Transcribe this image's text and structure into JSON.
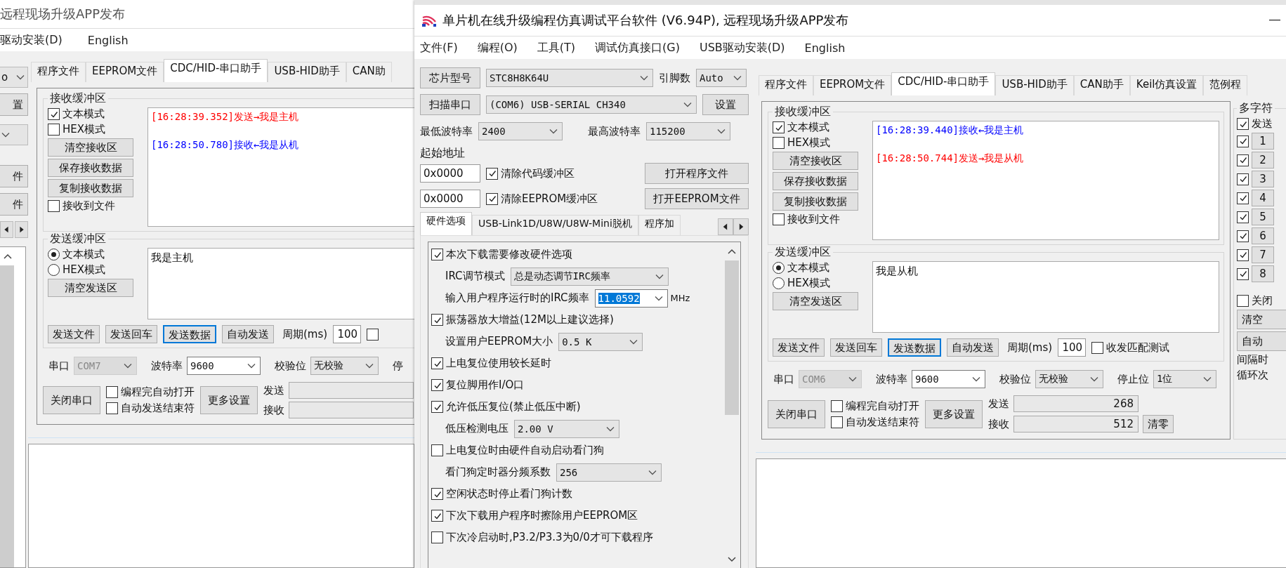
{
  "back_window": {
    "title": "远程现场升级APP发布",
    "menu": [
      "驱动安装(D)",
      "English"
    ],
    "edge_items": [
      {
        "kind": "combo",
        "value": "o"
      },
      {
        "kind": "button",
        "label": "置"
      },
      {
        "kind": "combo"
      },
      {
        "kind": "button",
        "label": "件"
      },
      {
        "kind": "button",
        "label": "件"
      },
      {
        "kind": "arrows"
      },
      {
        "kind": "list"
      }
    ],
    "tabs": [
      {
        "label": "程序文件",
        "selected": false
      },
      {
        "label": "EEPROM文件",
        "selected": false
      },
      {
        "label": "CDC/HID-串口助手",
        "selected": true
      },
      {
        "label": "USB-HID助手",
        "selected": false
      },
      {
        "label": "CAN助",
        "selected": false
      }
    ],
    "assistant": {
      "receive": {
        "title": "接收缓冲区",
        "options": [
          {
            "kind": "checkbox",
            "label": "文本模式",
            "checked": true
          },
          {
            "kind": "checkbox",
            "label": "HEX模式",
            "checked": false
          },
          {
            "kind": "button",
            "label": "清空接收区"
          },
          {
            "kind": "button",
            "label": "保存接收数据"
          },
          {
            "kind": "button",
            "label": "复制接收数据"
          },
          {
            "kind": "checkbox",
            "label": "接收到文件",
            "checked": false
          }
        ],
        "log": [
          {
            "text": "[16:28:39.352]发送→我是主机",
            "color": "#ff0000"
          },
          {
            "text": "[16:28:50.780]接收←我是从机",
            "color": "#0000ff"
          }
        ]
      },
      "send": {
        "title": "发送缓冲区",
        "options": [
          {
            "kind": "radio",
            "label": "文本模式",
            "selected": true
          },
          {
            "kind": "radio",
            "label": "HEX模式",
            "selected": false
          },
          {
            "kind": "button",
            "label": "清空发送区"
          }
        ],
        "text": "我是主机",
        "actions": [
          {
            "label": "发送文件",
            "focused": false
          },
          {
            "label": "发送回车",
            "focused": false
          },
          {
            "label": "发送数据",
            "focused": true
          },
          {
            "label": "自动发送",
            "focused": false
          }
        ],
        "period_label": "周期(ms)",
        "period": "100",
        "match_test": {
          "checked": false
        }
      },
      "port_row": [
        {
          "label": "串口",
          "value": "COM7",
          "disabled": true
        },
        {
          "label": "波特率",
          "value": "9600",
          "disabled": false
        },
        {
          "label": "校验位",
          "value": "无校验",
          "disabled": false
        },
        {
          "label": "停"
        }
      ],
      "bottom": {
        "close_button": "关闭串口",
        "checks": [
          {
            "label": "编程完自动打开",
            "checked": false
          },
          {
            "label": "自动发送结束符",
            "checked": false
          }
        ],
        "more_button": "更多设置",
        "counters": [
          {
            "label": "发送"
          },
          {
            "label": "接收"
          }
        ]
      }
    }
  },
  "front_window": {
    "title": "单片机在线升级编程仿真调试平台软件 (V6.94P), 远程现场升级APP发布",
    "menu": [
      "文件(F)",
      "编程(O)",
      "工具(T)",
      "调试仿真接口(G)",
      "USB驱动安装(D)",
      "English"
    ],
    "chip": {
      "button": "芯片型号",
      "value": "STC8H8K64U",
      "pins_label": "引脚数",
      "pins": "Auto"
    },
    "port": {
      "button": "扫描串口",
      "value": "(COM6) USB-SERIAL CH340",
      "settings_button": "设置"
    },
    "baud": {
      "min_label": "最低波特率",
      "min": "2400",
      "max_label": "最高波特率",
      "max": "115200"
    },
    "address": {
      "label": "起始地址",
      "rows": [
        {
          "value": "0x0000",
          "check_label": "清除代码缓冲区",
          "checked": true,
          "button": "打开程序文件"
        },
        {
          "value": "0x0000",
          "check_label": "清除EEPROM缓冲区",
          "checked": true,
          "button": "打开EEPROM文件"
        }
      ]
    },
    "option_tabs": [
      {
        "label": "硬件选项",
        "selected": true
      },
      {
        "label": "USB-Link1D/U8W/U8W-Mini脱机",
        "selected": false
      },
      {
        "label": "程序加",
        "selected": false
      }
    ],
    "hardware_options": [
      {
        "kind": "checkbox",
        "label": "本次下载需要修改硬件选项",
        "checked": true
      },
      {
        "kind": "select",
        "label": "IRC调节模式",
        "value": "总是动态调节IRC频率"
      },
      {
        "kind": "combo",
        "label": "输入用户程序运行时的IRC频率",
        "value": "11.0592",
        "value_selected": true,
        "unit": "MHz"
      },
      {
        "kind": "checkbox",
        "label": "振荡器放大增益(12M以上建议选择)",
        "checked": true
      },
      {
        "kind": "select",
        "label": "设置用户EEPROM大小",
        "value": "0.5 K"
      },
      {
        "kind": "checkbox",
        "label": "上电复位使用较长延时",
        "checked": true
      },
      {
        "kind": "checkbox",
        "label": "复位脚用作I/O口",
        "checked": true
      },
      {
        "kind": "checkbox",
        "label": "允许低压复位(禁止低压中断)",
        "checked": true
      },
      {
        "kind": "select",
        "label": "低压检测电压",
        "value": "2.00 V"
      },
      {
        "kind": "checkbox",
        "label": "上电复位时由硬件自动启动看门狗",
        "checked": false
      },
      {
        "kind": "select",
        "label": "看门狗定时器分频系数",
        "value": "256"
      },
      {
        "kind": "checkbox",
        "label": "空闲状态时停止看门狗计数",
        "checked": true
      },
      {
        "kind": "checkbox",
        "label": "下次下载用户程序时擦除用户EEPROM区",
        "checked": true
      },
      {
        "kind": "checkbox",
        "label": "下次冷启动时,P3.2/P3.3为0/0才可下载程序",
        "checked": false
      }
    ],
    "tabs": [
      {
        "label": "程序文件",
        "selected": false
      },
      {
        "label": "EEPROM文件",
        "selected": false
      },
      {
        "label": "CDC/HID-串口助手",
        "selected": true
      },
      {
        "label": "USB-HID助手",
        "selected": false
      },
      {
        "label": "CAN助手",
        "selected": false
      },
      {
        "label": "Keil仿真设置",
        "selected": false
      },
      {
        "label": "范例程",
        "selected": false
      }
    ],
    "assistant": {
      "receive": {
        "title": "接收缓冲区",
        "options": [
          {
            "kind": "checkbox",
            "label": "文本模式",
            "checked": true
          },
          {
            "kind": "checkbox",
            "label": "HEX模式",
            "checked": false
          },
          {
            "kind": "button",
            "label": "清空接收区"
          },
          {
            "kind": "button",
            "label": "保存接收数据"
          },
          {
            "kind": "button",
            "label": "复制接收数据"
          },
          {
            "kind": "checkbox",
            "label": "接收到文件",
            "checked": false
          }
        ],
        "log": [
          {
            "text": "[16:28:39.440]接收←我是主机",
            "color": "#0000ff"
          },
          {
            "text": "[16:28:50.744]发送→我是从机",
            "color": "#ff0000"
          }
        ]
      },
      "send": {
        "title": "发送缓冲区",
        "options": [
          {
            "kind": "radio",
            "label": "文本模式",
            "selected": true
          },
          {
            "kind": "radio",
            "label": "HEX模式",
            "selected": false
          },
          {
            "kind": "button",
            "label": "清空发送区"
          }
        ],
        "text": "我是从机",
        "actions": [
          {
            "label": "发送文件",
            "focused": false
          },
          {
            "label": "发送回车",
            "focused": false
          },
          {
            "label": "发送数据",
            "focused": true
          },
          {
            "label": "自动发送",
            "focused": false
          }
        ],
        "period_label": "周期(ms)",
        "period": "100",
        "match_test": {
          "label": "收发匹配测试",
          "checked": false
        }
      },
      "port_row": [
        {
          "label": "串口",
          "value": "COM6",
          "disabled": true
        },
        {
          "label": "波特率",
          "value": "9600",
          "disabled": false
        },
        {
          "label": "校验位",
          "value": "无校验",
          "disabled": false
        },
        {
          "label": "停止位",
          "value": "1位",
          "disabled": false
        }
      ],
      "bottom": {
        "close_button": "关闭串口",
        "checks": [
          {
            "label": "编程完自动打开",
            "checked": false
          },
          {
            "label": "自动发送结束符",
            "checked": false
          }
        ],
        "more_button": "更多设置",
        "counters": [
          {
            "label": "发送",
            "value": "268"
          },
          {
            "label": "接收",
            "value": "512"
          }
        ],
        "clear_button": "清零"
      }
    },
    "multi_send": {
      "title": "多字符",
      "send_check": {
        "label": "发送",
        "checked": true
      },
      "items": [
        {
          "label": "1",
          "checked": true
        },
        {
          "label": "2",
          "checked": true
        },
        {
          "label": "3",
          "checked": true
        },
        {
          "label": "4",
          "checked": true
        },
        {
          "label": "5",
          "checked": true
        },
        {
          "label": "6",
          "checked": true
        },
        {
          "label": "7",
          "checked": true
        },
        {
          "label": "8",
          "checked": true
        }
      ],
      "close_check": {
        "label": "关闭",
        "checked": false
      },
      "buttons": [
        "清空",
        "自动"
      ],
      "labels": [
        "间隔时",
        "循环次"
      ]
    }
  }
}
